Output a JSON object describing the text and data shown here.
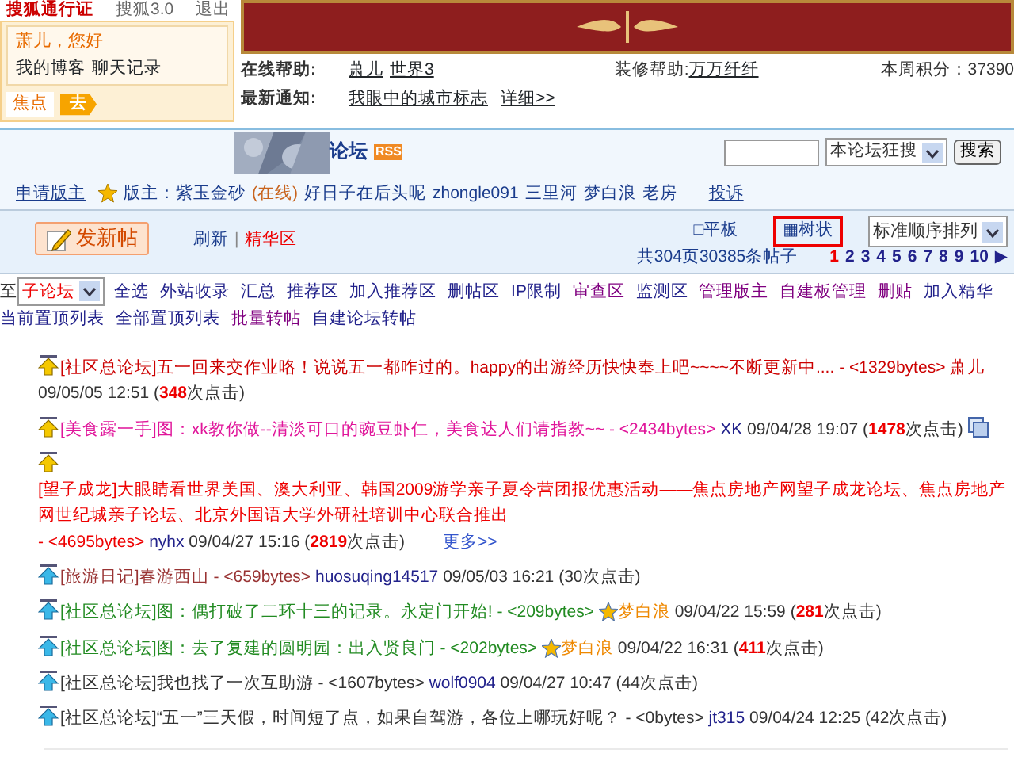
{
  "top_links": [
    "搜狐通行证",
    "搜狐3.0",
    "退出"
  ],
  "user_panel": {
    "greeting": "萧儿，您好",
    "links": [
      "我的博客",
      "聊天记录"
    ],
    "tab": "焦点",
    "go": "去"
  },
  "info": {
    "help_label": "在线帮助:",
    "help_links": [
      "萧儿",
      "世界3"
    ],
    "decor_label": "装修帮助:",
    "decor_link": "万万纤纤",
    "points": "本周积分：37390",
    "notice_label": "最新通知:",
    "notice_link": "我眼中的城市标志",
    "detail_link": "详细>>"
  },
  "forum": {
    "kind": "picture",
    "title": "论坛",
    "rss": "RSS",
    "search_scope": "本论坛狂搜",
    "search_button": "搜索"
  },
  "moderators": {
    "apply": "申请版主",
    "label": "版主：紫玉金砂",
    "online": "(在线)",
    "names": [
      "好日子在后头呢",
      "zhongle091",
      "三里河",
      "梦白浪",
      "老房"
    ],
    "complain": "投诉"
  },
  "toolbar": {
    "new_post": "发新帖",
    "refresh": "刷新",
    "sep": "|",
    "digest": "精华区",
    "views": [
      {
        "icon": "□",
        "label": "平板",
        "selected": false
      },
      {
        "icon": "▦",
        "label": "树状",
        "selected": true
      }
    ],
    "sort": "标准顺序排列",
    "total": "共304页30385条帖子",
    "pages": [
      {
        "label": "1",
        "selected": true
      },
      {
        "label": "2",
        "selected": false
      },
      {
        "label": "3",
        "selected": false
      },
      {
        "label": "4",
        "selected": false
      },
      {
        "label": "5",
        "selected": false
      },
      {
        "label": "6",
        "selected": false
      },
      {
        "label": "7",
        "selected": false
      },
      {
        "label": "8",
        "selected": false
      },
      {
        "label": "9",
        "selected": false
      },
      {
        "label": "10",
        "selected": false
      }
    ],
    "next": "▶"
  },
  "admin": {
    "move_label": "至",
    "move_target": "子论坛",
    "links": [
      {
        "label": "全选",
        "color": "#22228b"
      },
      {
        "label": "外站收录",
        "color": "#22228b"
      },
      {
        "label": "汇总",
        "color": "#22228b"
      },
      {
        "label": "推荐区",
        "color": "#22228b"
      },
      {
        "label": "加入推荐区",
        "color": "#22228b"
      },
      {
        "label": "删帖区",
        "color": "#22228b"
      },
      {
        "label": "IP限制",
        "color": "#22228b"
      },
      {
        "label": "审查区",
        "color": "#800080"
      },
      {
        "label": "监测区",
        "color": "#22228b"
      },
      {
        "label": "管理版主",
        "color": "#800080"
      },
      {
        "label": "自建板管理",
        "color": "#800080"
      },
      {
        "label": "删贴",
        "color": "#800080"
      },
      {
        "label": "加入精华",
        "color": "#22228b"
      },
      {
        "label": "当前置顶列表",
        "color": "#22228b"
      },
      {
        "label": "全部置顶列表",
        "color": "#22228b"
      },
      {
        "label": "批量转帖",
        "color": "#800080"
      },
      {
        "label": "自建论坛转帖",
        "color": "#22228b"
      }
    ]
  },
  "posts": [
    {
      "title": "[社区总论坛]五一回来交作业咯！说说五一都咋过的。happy的出游经历快快奉上吧~~~~不断更新中....",
      "color": "#cc0000",
      "bytes": "- <1329bytes>",
      "author": {
        "name": "萧儿",
        "color": "#cc0000"
      },
      "star": false,
      "date": "09/05/05 12:51",
      "clicks": "(**348**次点击)",
      "pages_icon": false
    },
    {
      "title": "[美食露一手]图：xk教你做--清淡可口的豌豆虾仁，美食达人们请指教~~",
      "color": "#e0159a",
      "bytes": "- <2434bytes>",
      "author": {
        "name": "XK",
        "color": "#22228b"
      },
      "star": false,
      "date": "09/04/28 19:07",
      "clicks": "(**1478**次点击)",
      "pages_icon": true
    },
    {
      "title": "[望子成龙]大眼睛看世界美国、澳大利亚、韩国2009游学亲子夏令营团报优惠活动——焦点房地产网望子成龙论坛、焦点房地产网世纪城亲子论坛、北京外国语大学外研社培训中心联合推出",
      "color": "#ee0000",
      "bytes": "- <4695bytes>",
      "author": {
        "name": "nyhx",
        "color": "#22228b"
      },
      "star": false,
      "date": "09/04/27 15:16",
      "clicks": "(**2819**次点击)",
      "pages_icon": false,
      "more": "更多>>"
    },
    {
      "title": "[旅游日记]春游西山",
      "color": "#993333",
      "bytes": "- <659bytes>",
      "author": {
        "name": "huosuqing14517",
        "color": "#22228b"
      },
      "star": false,
      "date": "09/05/03 16:21",
      "clicks": "(30次点击)",
      "pages_icon": false
    },
    {
      "title": "[社区总论坛]图：偶打破了二环十三的记录。永定门开始!",
      "color": "#228b22",
      "bytes": "- <209bytes>",
      "author": {
        "name": "梦白浪",
        "color": "#ee8800"
      },
      "star": true,
      "date": "09/04/22 15:59",
      "clicks": "(**281**次点击)",
      "pages_icon": false
    },
    {
      "title": "[社区总论坛]图：去了复建的圆明园：出入贤良门",
      "color": "#228b22",
      "bytes": "- <202bytes>",
      "author": {
        "name": "梦白浪",
        "color": "#ee8800"
      },
      "star": true,
      "date": "09/04/22 16:31",
      "clicks": "(**411**次点击)",
      "pages_icon": false
    },
    {
      "title": "[社区总论坛]我也找了一次互助游",
      "color": "#333333",
      "bytes": "- <1607bytes>",
      "author": {
        "name": "wolf0904",
        "color": "#22228b"
      },
      "star": false,
      "date": "09/04/27 10:47",
      "clicks": "(44次点击)",
      "pages_icon": false
    },
    {
      "title": "[社区总论坛]“五一”三天假，时间短了点，如果自驾游，各位上哪玩好呢？",
      "color": "#333333",
      "bytes": "- <0bytes>",
      "author": {
        "name": "jt315",
        "color": "#22228b"
      },
      "star": false,
      "date": "09/04/24 12:25",
      "clicks": "(42次点击)",
      "pages_icon": false
    }
  ]
}
